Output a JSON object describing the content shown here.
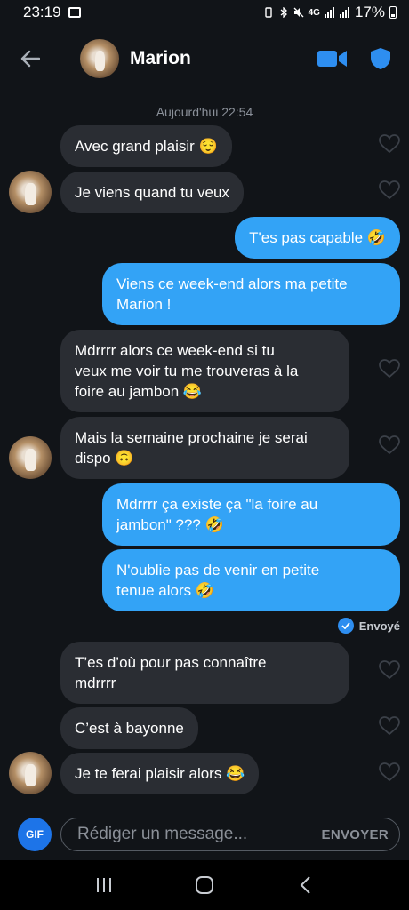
{
  "status_bar": {
    "time": "23:19",
    "network": "4G",
    "battery": "17%"
  },
  "header": {
    "contact_name": "Marion"
  },
  "chat": {
    "date_separator": "Aujourd'hui 22:54",
    "messages": [
      {
        "from": "them",
        "text": "Avec grand plaisir 😌"
      },
      {
        "from": "them",
        "text": "Je viens quand tu veux"
      },
      {
        "from": "me",
        "text": "T'es pas capable 🤣"
      },
      {
        "from": "me",
        "text": "Viens ce week-end alors ma petite\nMarion !"
      },
      {
        "from": "them",
        "text": "Mdrrrr alors ce week-end si tu\nveux me voir tu me trouveras à la\nfoire au jambon 😂"
      },
      {
        "from": "them",
        "text": "Mais la semaine prochaine je serai\ndispo 🙃"
      },
      {
        "from": "me",
        "text": "Mdrrrr ça existe ça \"la foire au\njambon\" ??? 🤣"
      },
      {
        "from": "me",
        "text": "N'oublie pas de venir en petite\ntenue alors 🤣"
      },
      {
        "from": "them",
        "text": "T’es d’où pour pas connaître\nmdrrrr"
      },
      {
        "from": "them",
        "text": "C’est à bayonne"
      },
      {
        "from": "them",
        "text": "Je te ferai plaisir alors 😂"
      }
    ],
    "sent_status": "Envoyé"
  },
  "composer": {
    "gif_label": "GIF",
    "placeholder": "Rédiger un message...",
    "send_label": "ENVOYER"
  },
  "colors": {
    "outgoing_bubble": "#33a3f6",
    "incoming_bubble": "#2a2d33",
    "accent": "#1d74e8",
    "background": "#111418"
  },
  "icons": {
    "back": "arrow-left-icon",
    "video": "video-camera-icon",
    "safety": "shield-icon",
    "like": "heart-outline-icon",
    "nav_recents": "recents-icon",
    "nav_home": "home-icon",
    "nav_back": "back-chevron-icon"
  }
}
